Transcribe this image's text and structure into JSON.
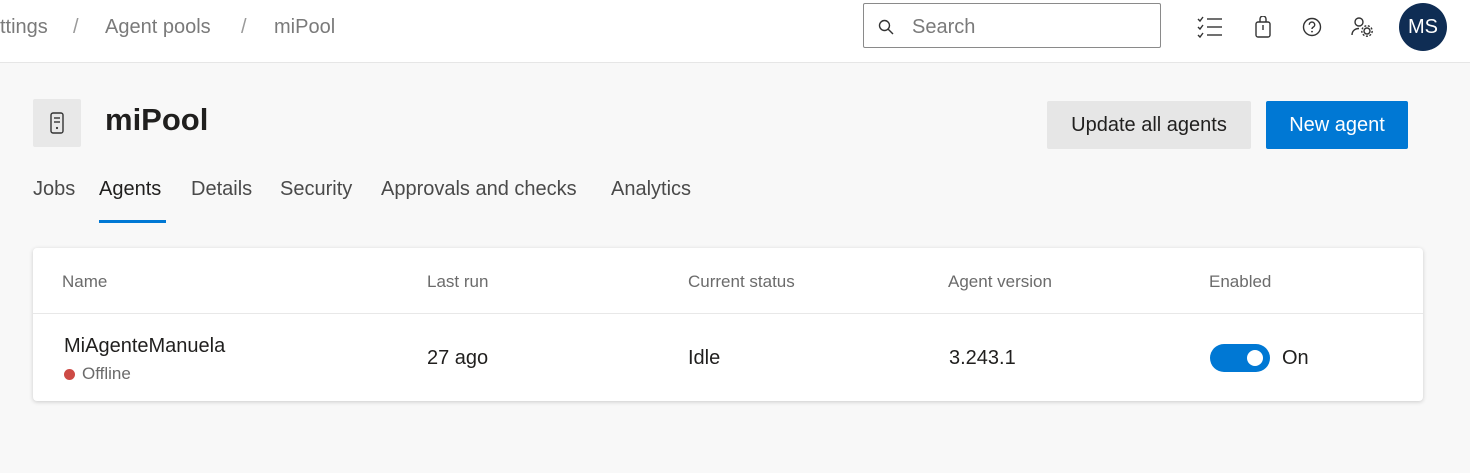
{
  "breadcrumb": {
    "items": [
      "ttings",
      "Agent pools",
      "miPool"
    ],
    "separator": "/"
  },
  "search": {
    "placeholder": "Search",
    "value": ""
  },
  "header_icons": [
    "task-list-icon",
    "shopping-bag-icon",
    "help-icon",
    "user-settings-icon"
  ],
  "user": {
    "initials": "MS"
  },
  "pool": {
    "title": "miPool",
    "icon": "agent-pool-icon"
  },
  "actions": {
    "update_all": "Update all agents",
    "new_agent": "New agent"
  },
  "tabs": [
    {
      "label": "Jobs",
      "active": false
    },
    {
      "label": "Agents",
      "active": true
    },
    {
      "label": "Details",
      "active": false
    },
    {
      "label": "Security",
      "active": false
    },
    {
      "label": "Approvals and checks",
      "active": false
    },
    {
      "label": "Analytics",
      "active": false
    }
  ],
  "table": {
    "columns": [
      "Name",
      "Last run",
      "Current status",
      "Agent version",
      "Enabled"
    ],
    "rows": [
      {
        "name": "MiAgenteManuela",
        "status": "Offline",
        "last_run": "27 ago",
        "current_status": "Idle",
        "version": "3.243.1",
        "enabled": true,
        "enabled_label": "On"
      }
    ]
  },
  "colors": {
    "accent": "#0078d4",
    "offline": "#cd4a45",
    "avatar_bg": "#0f2d54"
  }
}
